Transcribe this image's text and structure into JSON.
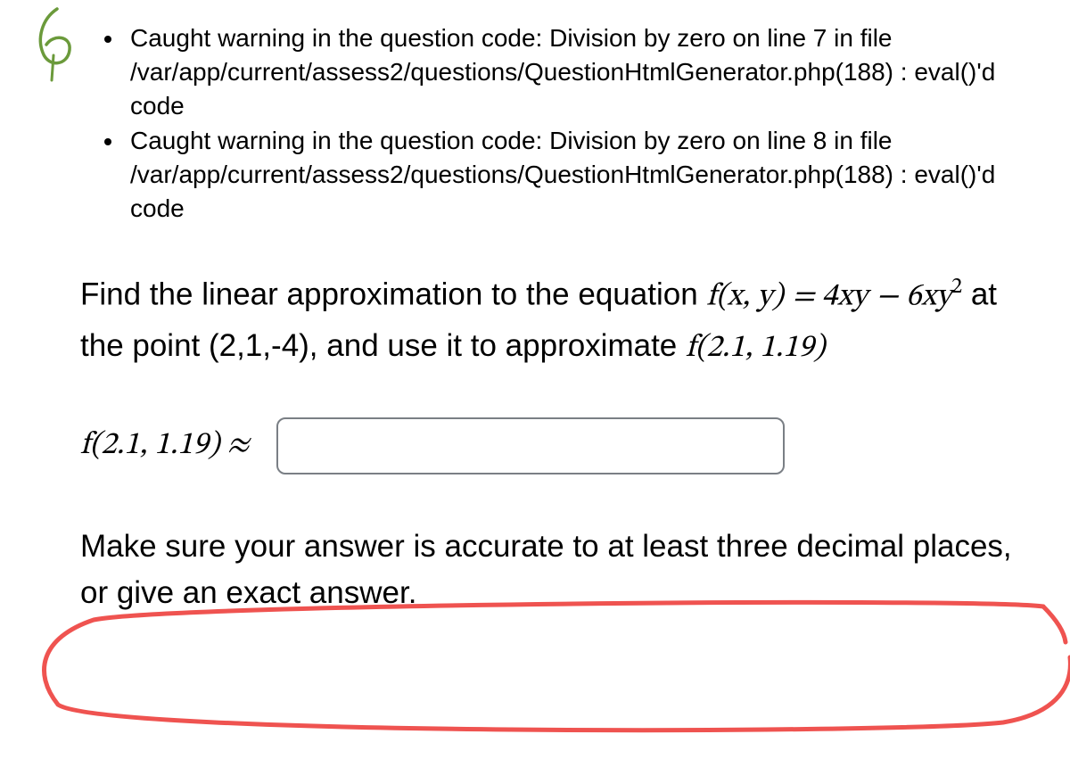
{
  "warnings": [
    "Caught warning in the question code: Division by zero on line 7 in file /var/app/current/assess2/questions/QuestionHtmlGenerator.php(188) : eval()'d code",
    "Caught warning in the question code: Division by zero on line 8 in file /var/app/current/assess2/questions/QuestionHtmlGenerator.php(188) : eval()'d code"
  ],
  "problem": {
    "intro": "Find the linear approximation to the equation ",
    "fxy": "f(x, y)",
    "eq": " = ",
    "term1": "4xy",
    "minus": " − ",
    "term2_base": "6xy",
    "term2_exp": "2",
    "mid": " at the point (2,1,-4), and use it to approximate ",
    "approx_expr": "f(2.1, 1.19)"
  },
  "answer": {
    "label_expr": "f(2.1, 1.19)",
    "approx_sym": " ≈ ",
    "value": ""
  },
  "note": "Make sure your answer is accurate to at least three decimal places, or give an exact answer.",
  "annotation": "6"
}
